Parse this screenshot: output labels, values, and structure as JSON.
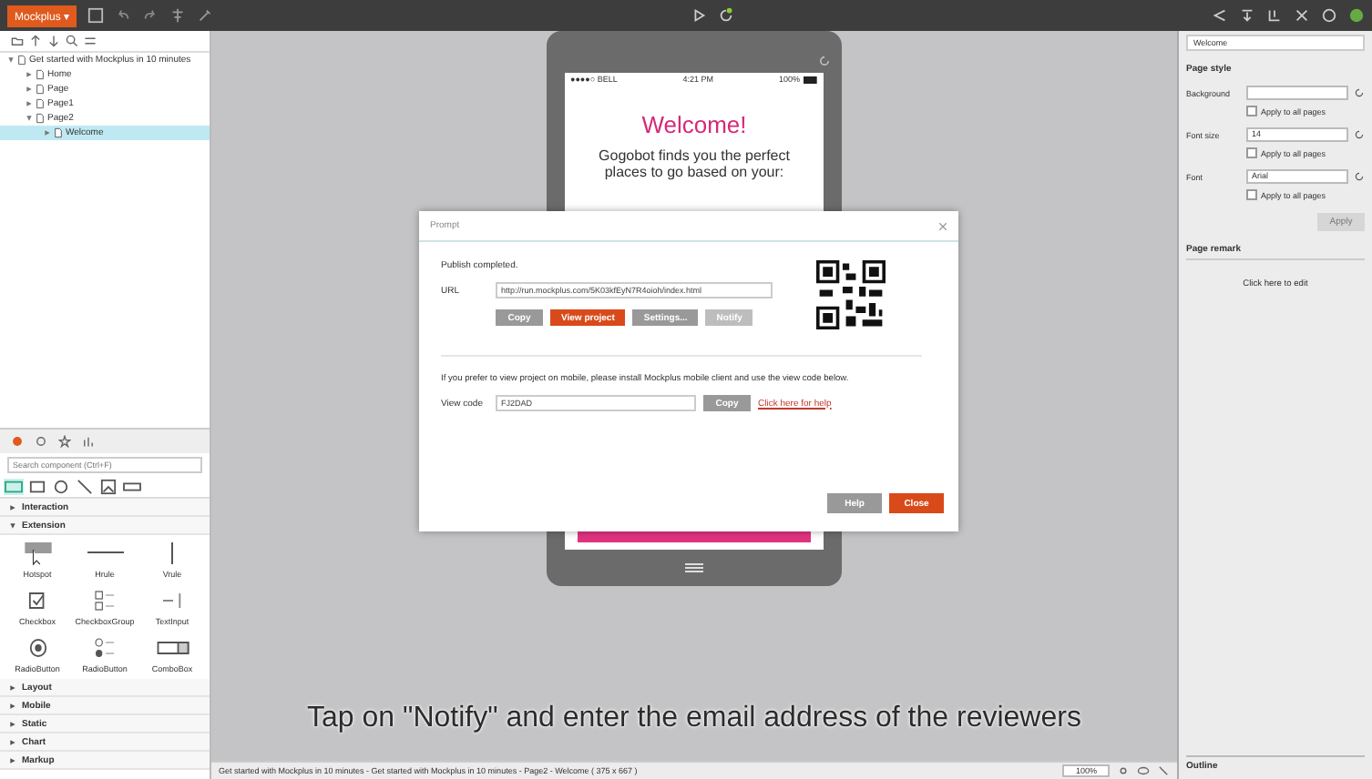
{
  "app_menu": {
    "label": "Mockplus ▾"
  },
  "tree": [
    {
      "label": "Get started with Mockplus in 10 minutes",
      "expanded": true,
      "selected": false,
      "children": [
        {
          "label": "Home",
          "expanded": false,
          "selected": false
        },
        {
          "label": "Page",
          "expanded": false,
          "selected": false
        },
        {
          "label": "Page1",
          "expanded": false,
          "selected": false
        },
        {
          "label": "Page2",
          "expanded": true,
          "selected": false,
          "children": [
            {
              "label": "Welcome",
              "expanded": false,
              "selected": true
            }
          ]
        }
      ]
    }
  ],
  "components": {
    "search": {
      "placeholder": "Search component (Ctrl+F)"
    },
    "categories": [
      {
        "label": "Interaction",
        "expanded": false
      },
      {
        "label": "Extension",
        "expanded": true,
        "items": [
          {
            "label": "Hotspot",
            "kind": "hotspot"
          },
          {
            "label": "Hrule",
            "kind": "hrule"
          },
          {
            "label": "Vrule",
            "kind": "vrule"
          },
          {
            "label": "Checkbox",
            "kind": "checkbox"
          },
          {
            "label": "CheckboxGroup",
            "kind": "checkgroup"
          },
          {
            "label": "TextInput",
            "kind": "textinput"
          },
          {
            "label": "RadioButton",
            "kind": "radio"
          },
          {
            "label": "RadioButton",
            "kind": "radiogroup"
          },
          {
            "label": "ComboBox",
            "kind": "combo"
          }
        ]
      },
      {
        "label": "Layout",
        "expanded": false
      },
      {
        "label": "Mobile",
        "expanded": false
      },
      {
        "label": "Static",
        "expanded": false
      },
      {
        "label": "Chart",
        "expanded": false
      },
      {
        "label": "Markup",
        "expanded": false
      }
    ]
  },
  "phone": {
    "carrier": "●●●●○ BELL",
    "time": "4:21 PM",
    "battery": "100%",
    "heading": "Welcome!",
    "text": "Gogobot finds you the perfect places to go based on your:"
  },
  "dialog": {
    "title": "Prompt",
    "message": "Publish completed.",
    "url_label": "URL",
    "url": "http://run.mockplus.com/5K03kfEyN7R4oioh/index.html",
    "buttons": [
      {
        "label": "Copy",
        "kind": "gray"
      },
      {
        "label": "View project",
        "kind": "primary"
      },
      {
        "label": "Settings...",
        "kind": "gray"
      },
      {
        "label": "Notify",
        "kind": "light"
      }
    ],
    "mobile_note": "If you prefer to view project on mobile, please install Mockplus mobile client and use the view code below.",
    "code_label": "View code",
    "code": "FJ2DAD",
    "code_copy": "Copy",
    "help_link": "Click here for help",
    "footer": [
      {
        "label": "Help",
        "kind": "gray"
      },
      {
        "label": "Close",
        "kind": "primary"
      }
    ]
  },
  "caption": "Tap on \"Notify\" and enter the email address of the reviewers",
  "status_bar": {
    "path": "Get started with Mockplus in 10 minutes - Get started with Mockplus in 10 minutes - Page2 - Welcome ( 375 x 667 )",
    "zoom": "100%"
  },
  "properties": {
    "page": "Welcome",
    "section": "Page style",
    "rows": [
      {
        "label": "Background",
        "value": "",
        "apply": "Apply to all pages",
        "checked": false
      },
      {
        "label": "Font size",
        "value": "14",
        "apply": "Apply to all pages",
        "checked": false
      },
      {
        "label": "Font",
        "value": "Arial",
        "apply": "Apply to all pages",
        "checked": false
      }
    ],
    "apply_button": {
      "label": "Apply",
      "disabled": true
    },
    "remark_title": "Page remark",
    "remark": "Click here to edit",
    "outline": "Outline"
  }
}
